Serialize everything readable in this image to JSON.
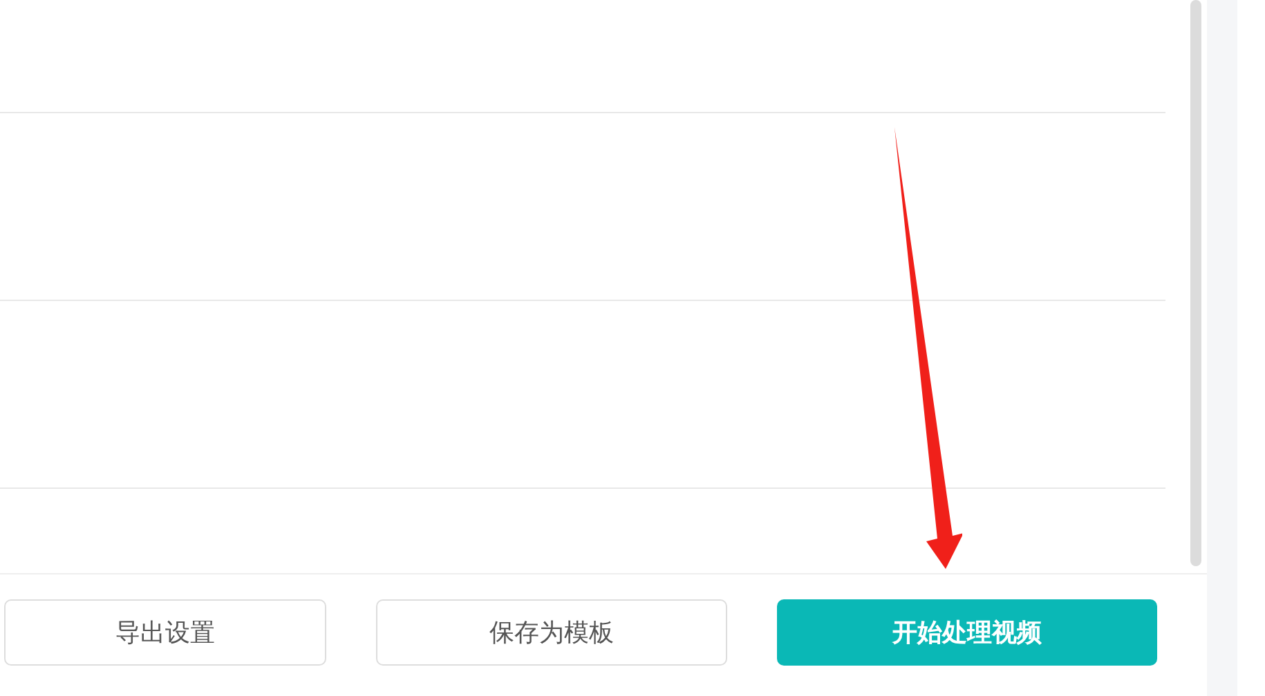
{
  "buttons": [
    {
      "label": "导出设置",
      "kind": "outline"
    },
    {
      "label": "保存为模板",
      "kind": "outline"
    },
    {
      "label": "开始处理视频",
      "kind": "primary"
    }
  ]
}
